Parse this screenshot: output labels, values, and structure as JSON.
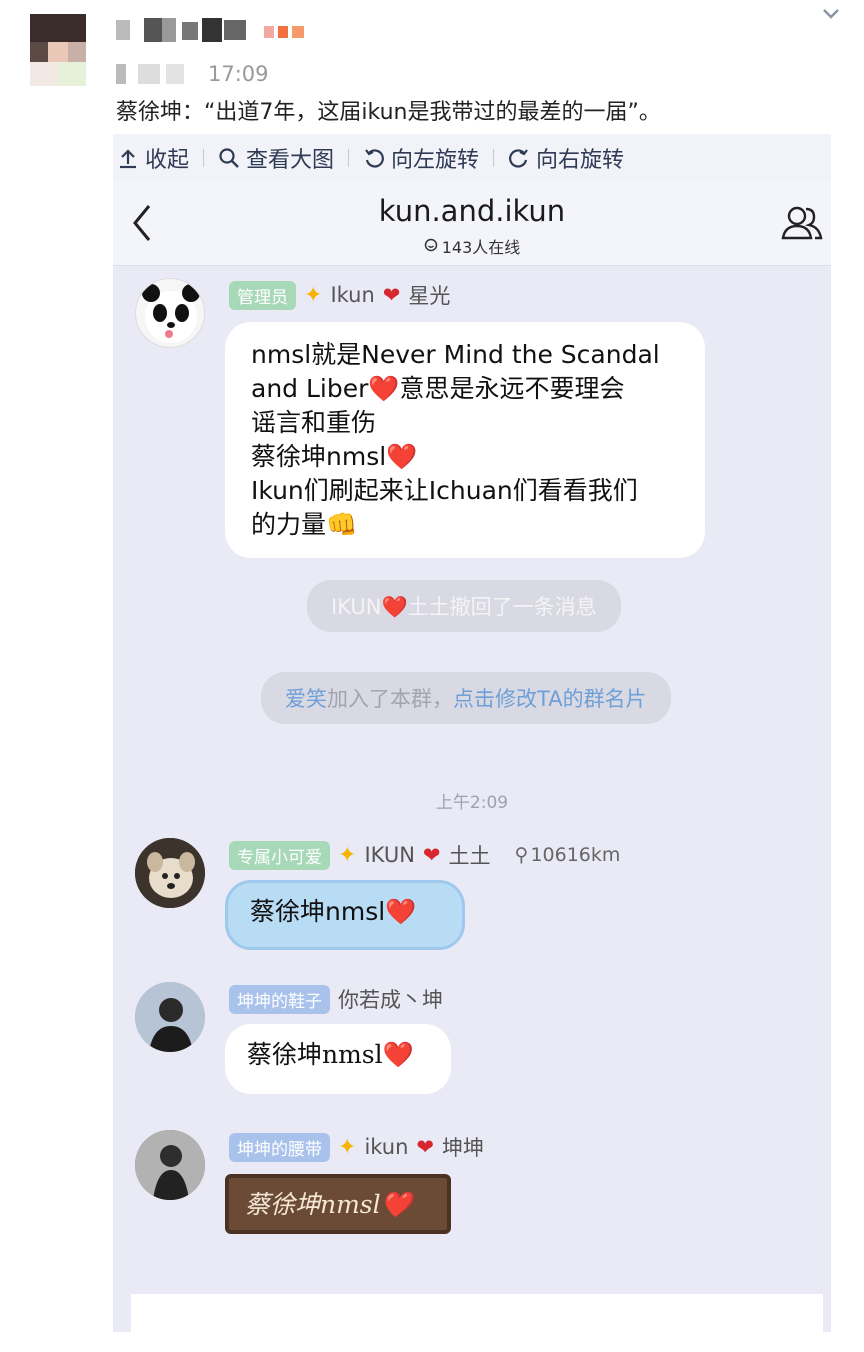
{
  "post": {
    "date_time": "17:09",
    "text": "蔡徐坤：“出道7年，这届ikun是我带过的最差的一届”。"
  },
  "toolbar": {
    "collapse_label": "收起",
    "view_large_label": "查看大图",
    "rotate_left_label": "向左旋转",
    "rotate_right_label": "向右旋转"
  },
  "chat": {
    "title": "kun.and.ikun",
    "online": "143人在线",
    "messages": [
      {
        "tag": "管理员",
        "name_before": "Ikun",
        "name_after": "星光",
        "text_lines": [
          "nmsl就是Never Mind the Scandal",
          "and Liber❤️意思是永远不要理会",
          "谣言和重伤",
          "蔡徐坤nmsl❤️",
          "Ikun们刷起来让Ichuan们看看我们",
          "的力量👊"
        ]
      },
      {
        "tag": "专属小可爱",
        "name_before": "IKUN",
        "name_after": "土土",
        "location": "10616km",
        "text": "蔡徐坤nmsl❤️"
      },
      {
        "tag": "坤坤的鞋子",
        "name": "你若成丶坤",
        "text": "蔡徐坤nmsl❤️"
      },
      {
        "tag": "坤坤的腰带",
        "name_before": "ikun",
        "name_after": "坤坤",
        "text": "蔡徐坤nmsl❤️"
      }
    ],
    "system_recall": "IKUN❤️土土撤回了一条消息",
    "system_join": {
      "name": "爱笑",
      "middle": " 加入了本群，",
      "link": "点击修改TA的群名片"
    },
    "time_label": "上午2:09"
  },
  "icons": {
    "collapse": "arrow-up-icon",
    "search": "search-icon",
    "rotate_left": "rotate-left-icon",
    "rotate_right": "rotate-right-icon",
    "back": "back-chevron-icon",
    "members": "group-members-icon"
  },
  "colors": {
    "toolbar_text": "#2f3a55",
    "tag_green": "#a7d9b9",
    "tag_blue": "#a9c2ec",
    "heart": "#d7262d",
    "link_blue": "#6f9fd8"
  }
}
